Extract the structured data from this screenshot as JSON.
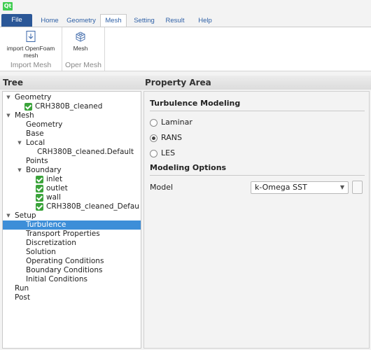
{
  "app": {
    "logo_text": "Qt"
  },
  "tabs": [
    "File",
    "Home",
    "Geometry",
    "Mesh",
    "Setting",
    "Result",
    "Help"
  ],
  "active_tab": "Mesh",
  "ribbon": {
    "groups": [
      {
        "label": "Import Mesh",
        "buttons": [
          {
            "label": "import OpenFoam mesh",
            "icon": "import-mesh-icon"
          }
        ]
      },
      {
        "label": "Oper Mesh",
        "buttons": [
          {
            "label": "Mesh",
            "icon": "mesh-cube-icon"
          }
        ]
      }
    ]
  },
  "tree": {
    "title": "Tree",
    "nodes": [
      {
        "label": "Geometry",
        "expanded": true
      },
      {
        "label": "CRH380B_cleaned",
        "checked": true
      },
      {
        "label": "Mesh",
        "expanded": true
      },
      {
        "label": "Geometry"
      },
      {
        "label": "Base"
      },
      {
        "label": "Local",
        "expanded": true
      },
      {
        "label": "CRH380B_cleaned.Default"
      },
      {
        "label": "Points"
      },
      {
        "label": "Boundary",
        "expanded": true
      },
      {
        "label": "inlet",
        "checked": true
      },
      {
        "label": "outlet",
        "checked": true
      },
      {
        "label": "wall",
        "checked": true
      },
      {
        "label": "CRH380B_cleaned_Defau",
        "checked": true
      },
      {
        "label": "Setup",
        "expanded": true
      },
      {
        "label": "Turbulence",
        "selected": true
      },
      {
        "label": "Transport Properties"
      },
      {
        "label": "Discretization"
      },
      {
        "label": "Solution"
      },
      {
        "label": "Operating Conditions"
      },
      {
        "label": "Boundary Conditions"
      },
      {
        "label": "Initial Conditions"
      },
      {
        "label": "Run"
      },
      {
        "label": "Post"
      }
    ]
  },
  "property": {
    "title": "Property Area",
    "turbulence_heading": "Turbulence Modeling",
    "options": [
      "Laminar",
      "RANS",
      "LES"
    ],
    "selected_option": "RANS",
    "modeling_heading": "Modeling Options",
    "model_label": "Model",
    "model_value": "k-Omega SST"
  },
  "colors": {
    "accent": "#2b5797",
    "selection": "#3d8ed8",
    "check": "#3aa33a"
  }
}
